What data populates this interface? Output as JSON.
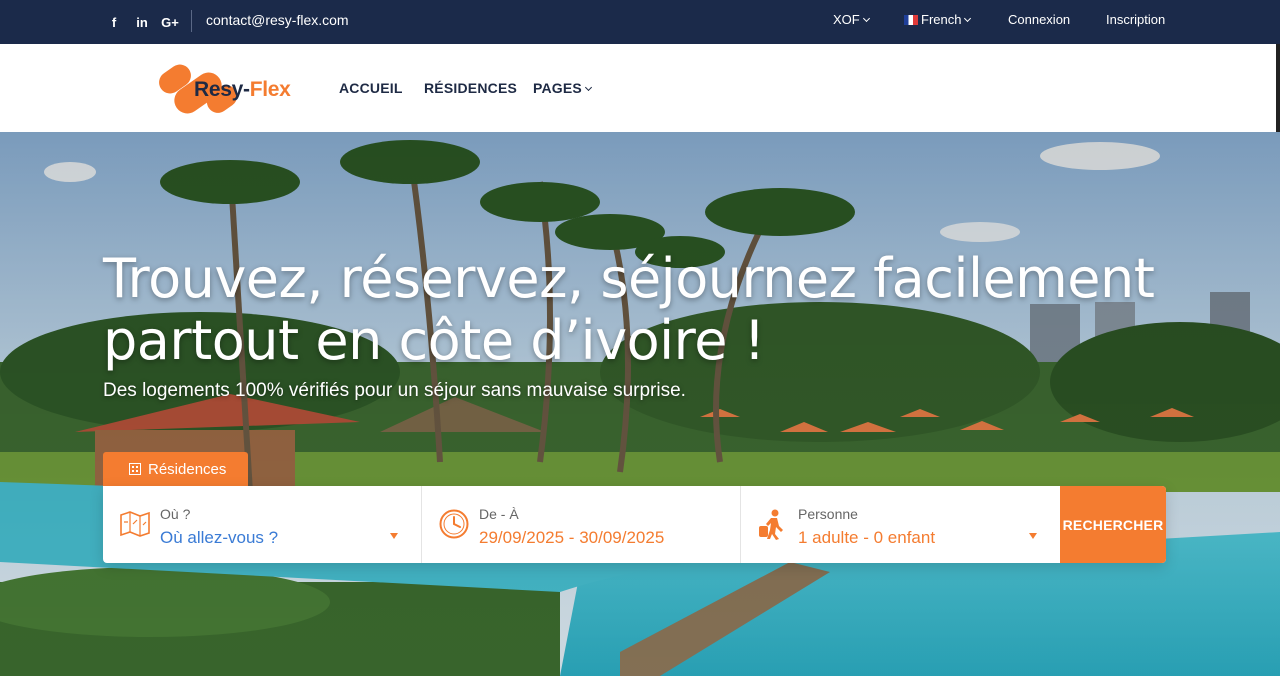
{
  "topbar": {
    "social": [
      {
        "name": "facebook-icon",
        "glyph": "f"
      },
      {
        "name": "linkedin-icon",
        "glyph": "in"
      },
      {
        "name": "google-plus-icon",
        "glyph": "G+"
      }
    ],
    "email": "contact@resy-flex.com",
    "currency": "XOF",
    "language": "French",
    "login": "Connexion",
    "register": "Inscription"
  },
  "header": {
    "logo_text_main": "Resy-",
    "logo_text_accent": "Flex",
    "nav": {
      "home": "ACCUEIL",
      "residences": "RÉSIDENCES",
      "pages": "PAGES"
    }
  },
  "hero": {
    "title_line1": "Trouvez, réservez, séjournez facilement",
    "title_line2": "partout en côte d’ivoire !",
    "subtitle": "Des logements 100% vérifiés pour un séjour sans mauvaise surprise."
  },
  "search": {
    "tab_label": "Résidences",
    "where_label": "Où ?",
    "where_value": "Où allez-vous ?",
    "dates_label": "De - À",
    "dates_value": "29/09/2025 - 30/09/2025",
    "persons_label": "Personne",
    "persons_value": "1 adulte - 0 enfant",
    "button": "RECHERCHER"
  },
  "colors": {
    "accent": "#f47c30",
    "topbar_bg": "#1b2a4a",
    "nav_text": "#1e2a44",
    "link_blue": "#3a7bd5"
  }
}
